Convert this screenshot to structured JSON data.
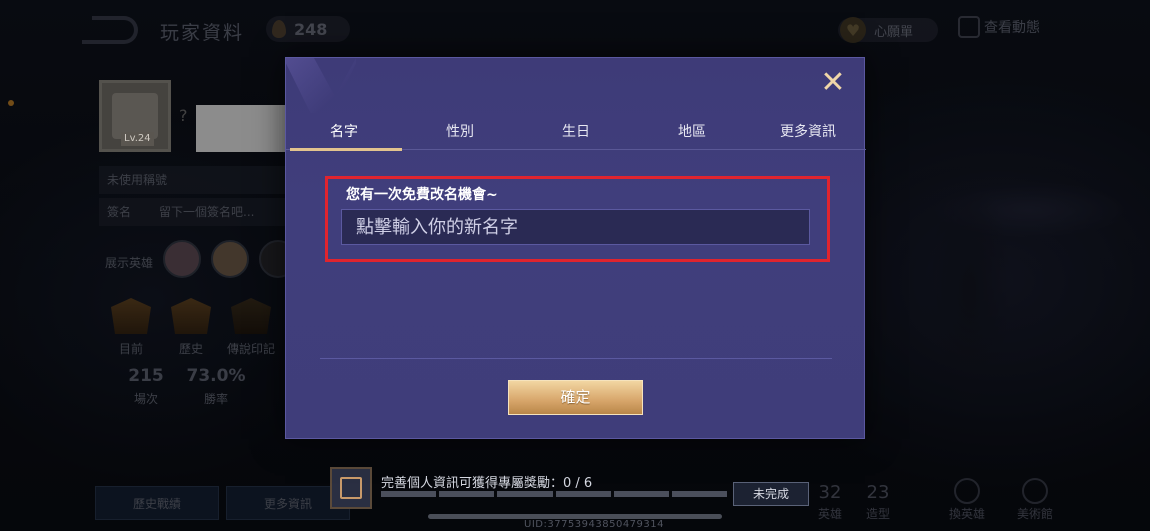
{
  "header": {
    "title": "玩家資料",
    "fire_count": "248",
    "wishlist_label": "心願單",
    "activity_label": "查看動態"
  },
  "profile": {
    "level": "Lv.24",
    "unknown_mark": "?",
    "title_placeholder": "未使用稱號",
    "sign_label": "簽名",
    "sign_placeholder": "留下一個簽名吧...",
    "showcase_label": "展示英雄",
    "ranks": [
      "目前",
      "歷史",
      "傳說印記"
    ],
    "stats": [
      {
        "value": "215",
        "label": "場次"
      },
      {
        "value": "73.0%",
        "label": "勝率"
      }
    ],
    "history_button": "歷史戰績",
    "more_button": "更多資訊"
  },
  "bottom_right": {
    "stats": [
      {
        "value": "32",
        "label": "英雄"
      },
      {
        "value": "23",
        "label": "造型"
      }
    ],
    "icons": [
      {
        "label": "換英雄"
      },
      {
        "label": "美術館"
      }
    ]
  },
  "reward_strip": {
    "text": "完善個人資訊可獲得專屬獎勵：0 / 6",
    "progress_done": 0,
    "progress_total": 6,
    "button": "未完成",
    "uid": "UID:37753943850479314"
  },
  "modal": {
    "close_symbol": "✕",
    "tabs": [
      "名字",
      "性別",
      "生日",
      "地區",
      "更多資訊"
    ],
    "active_tab": 0,
    "hint": "您有一次免費改名機會~",
    "input_placeholder": "點擊輸入你的新名字",
    "input_value": "",
    "confirm": "確定"
  },
  "colors": {
    "modal_bg": "#3f3d7a",
    "accent_gold": "#e2c48e",
    "highlight_red": "#e0242e"
  }
}
